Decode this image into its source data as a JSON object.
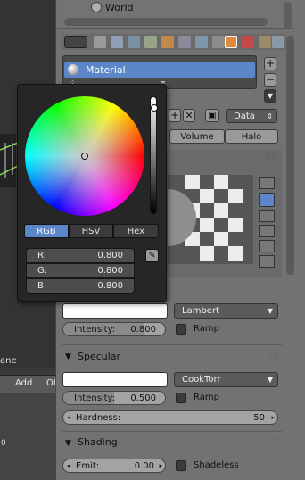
{
  "outliner": {
    "world_label": "World"
  },
  "material_slot": {
    "name": "Material"
  },
  "data_menu": {
    "label": "Data"
  },
  "type_tabs": [
    {
      "label": "Volume"
    },
    {
      "label": "Halo"
    }
  ],
  "viewport": {
    "object_label": "ane",
    "add_label": "Add",
    "ob_label": "Ob",
    "frame_label": "0"
  },
  "color_picker": {
    "modes": [
      {
        "label": "RGB",
        "active": true
      },
      {
        "label": "HSV",
        "active": false
      },
      {
        "label": "Hex",
        "active": false
      }
    ],
    "channels": [
      {
        "label": "R:",
        "value": "0.800"
      },
      {
        "label": "G:",
        "value": "0.800"
      },
      {
        "label": "B:",
        "value": "0.800"
      }
    ]
  },
  "diffuse": {
    "shader": "Lambert",
    "intensity_label": "Intensity:",
    "intensity_value": "0.800",
    "ramp_label": "Ramp"
  },
  "specular": {
    "title": "Specular",
    "shader": "CookTorr",
    "intensity_label": "Intensity:",
    "intensity_value": "0.500",
    "ramp_label": "Ramp",
    "hardness_label": "Hardness:",
    "hardness_value": "50"
  },
  "shading": {
    "title": "Shading",
    "emit_label": "Emit:",
    "emit_value": "0.00",
    "shadeless_label": "Shadeless"
  },
  "colors": {
    "selection": "#5b86c8",
    "panel": "#727272",
    "popup": "#262626"
  }
}
